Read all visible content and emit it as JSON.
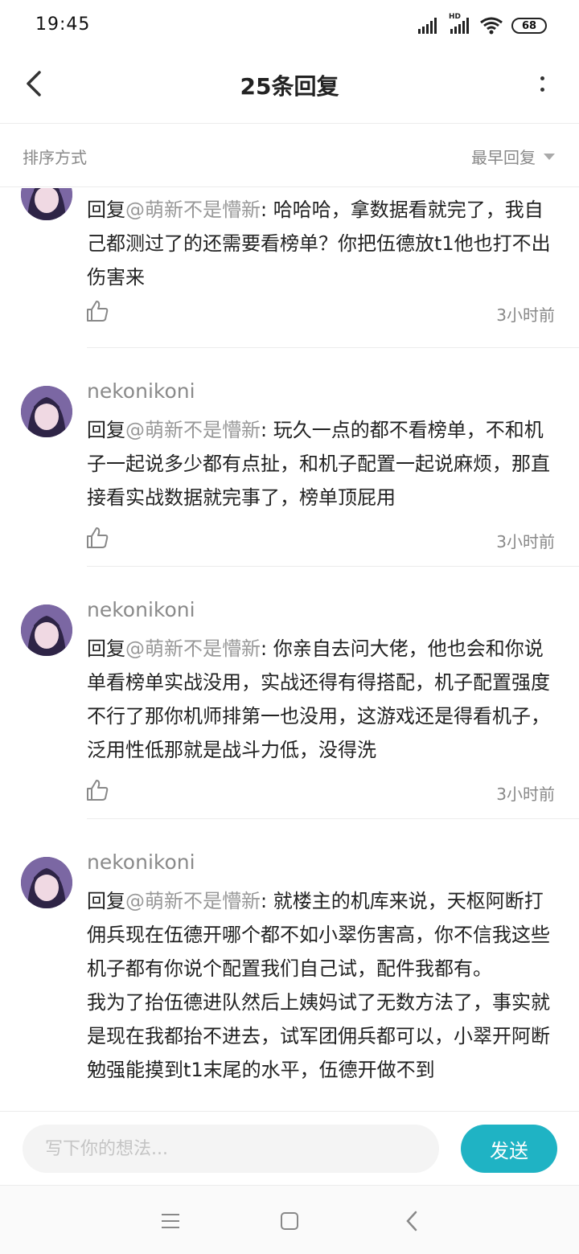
{
  "status_bar": {
    "time": "19:45",
    "network": "HD",
    "battery": "68"
  },
  "header": {
    "title": "25条回复"
  },
  "sort": {
    "label": "排序方式",
    "selected": "最早回复"
  },
  "replies": [
    {
      "author": "",
      "prefix": "回复",
      "mention": "@萌新不是懵新",
      "text": ": 哈哈哈，拿数据看就完了，我自己都测过了的还需要看榜单？你把伍德放t1他也打不出伤害来",
      "time": "3小时前"
    },
    {
      "author": "nekonikoni",
      "prefix": "回复",
      "mention": "@萌新不是懵新",
      "text": ": 玩久一点的都不看榜单，不和机子一起说多少都有点扯，和机子配置一起说麻烦，那直接看实战数据就完事了，榜单顶屁用",
      "time": "3小时前"
    },
    {
      "author": "nekonikoni",
      "prefix": "回复",
      "mention": "@萌新不是懵新",
      "text": ": 你亲自去问大佬，他也会和你说单看榜单实战没用，实战还得有得搭配，机子配置强度不行了那你机师排第一也没用，这游戏还是得看机子，泛用性低那就是战斗力低，没得洗",
      "time": "3小时前"
    },
    {
      "author": "nekonikoni",
      "prefix": "回复",
      "mention": "@萌新不是懵新",
      "text": ": 就楼主的机库来说，天枢阿断打佣兵现在伍德开哪个都不如小翠伤害高，你不信我这些机子都有你说个配置我们自己试，配件我都有。",
      "text2": "我为了抬伍德进队然后上姨妈试了无数方法了，事实就是现在我都抬不进去，试军团佣兵都可以，小翠开阿断勉强能摸到t1末尾的水平，伍德开做不到"
    }
  ],
  "input": {
    "placeholder": "写下你的想法...",
    "send_label": "发送"
  }
}
